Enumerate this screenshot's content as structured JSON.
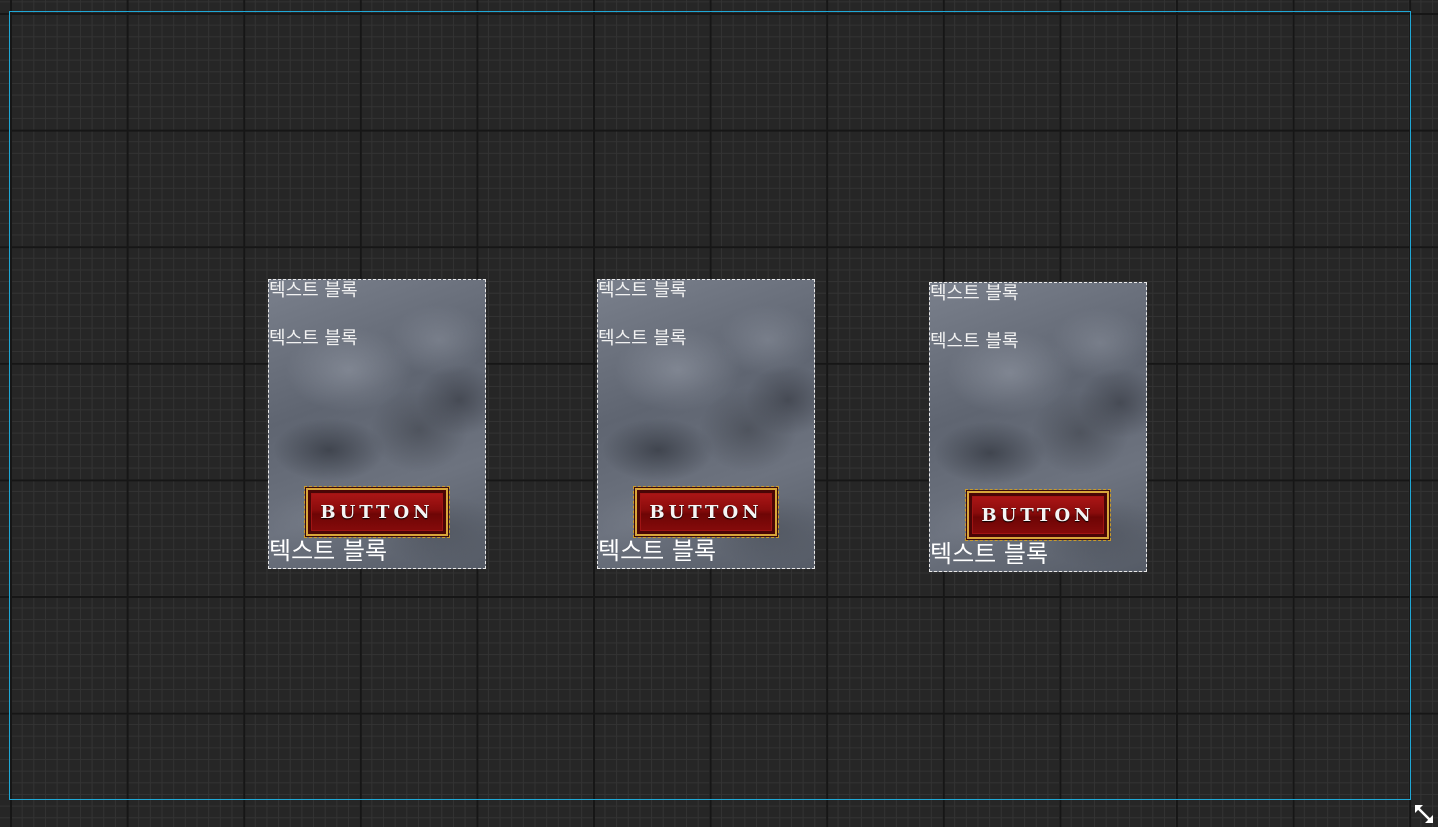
{
  "canvas": {
    "accent": "#1fa8d6",
    "resize_icon": "resize-diagonal-icon"
  },
  "cards": [
    {
      "text_top": "텍스트 블록",
      "text_middle": "텍스트 블록",
      "button_label": "BUTTON",
      "text_bottom": "텍스트 블록"
    },
    {
      "text_top": "텍스트 블록",
      "text_middle": "텍스트 블록",
      "button_label": "BUTTON",
      "text_bottom": "텍스트 블록"
    },
    {
      "text_top": "텍스트 블록",
      "text_middle": "텍스트 블록",
      "button_label": "BUTTON",
      "text_bottom": "텍스트 블록"
    }
  ]
}
